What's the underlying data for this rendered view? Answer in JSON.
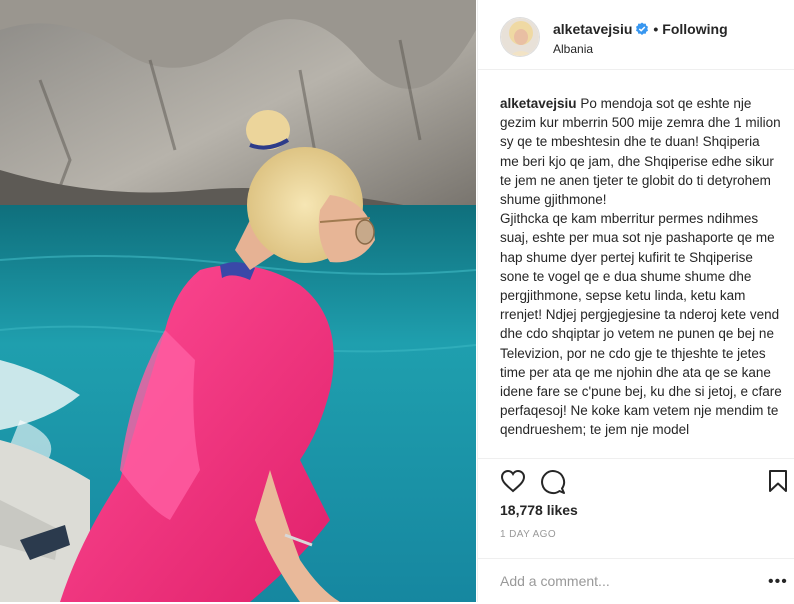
{
  "post": {
    "username": "alketavejsiu",
    "follow_status": "Following",
    "separator": "•",
    "location": "Albania",
    "caption_user": "alketavejsiu",
    "caption_text": "Po mendoja sot qe eshte nje gezim kur mberrin 500 mije zemra dhe 1 milion sy qe te mbeshtesin dhe te duan! Shqiperia me beri kjo qe jam, dhe Shqiperise edhe sikur te jem ne anen tjeter te globit do ti detyrohem shume gjithmone!\nGjithcka qe kam mberritur permes ndihmes suaj, eshte per mua sot nje pashaporte qe me hap shume dyer pertej kufirit te Shqiperise sone te vogel qe e dua shume shume dhe pergjithmone, sepse ketu linda, ketu kam rrenjet! Ndjej pergjegjesine ta nderoj kete vend dhe cdo shqiptar jo vetem ne punen qe bej ne Televizion, por ne cdo gje te thjeshte te jetes time per ata qe me njohin dhe ata qe se kane idene fare se c'pune bej, ku dhe si jetoj, e cfare perfaqesoj! Ne koke kam vetem nje mendim te qendrueshem; te jem nje model",
    "likes": "18,778 likes",
    "timestamp": "1 DAY AGO",
    "comment_placeholder": "Add a comment...",
    "more_label": "•••"
  },
  "icons": {
    "like": "heart-outline-icon",
    "comment": "speech-bubble-icon",
    "save": "bookmark-outline-icon",
    "verified": "verified-badge-icon"
  },
  "colors": {
    "verified_blue": "#3897f0",
    "text": "#262626",
    "muted": "#999999",
    "dress_pink": "#f0357c",
    "sea": "#1e9aa8"
  }
}
